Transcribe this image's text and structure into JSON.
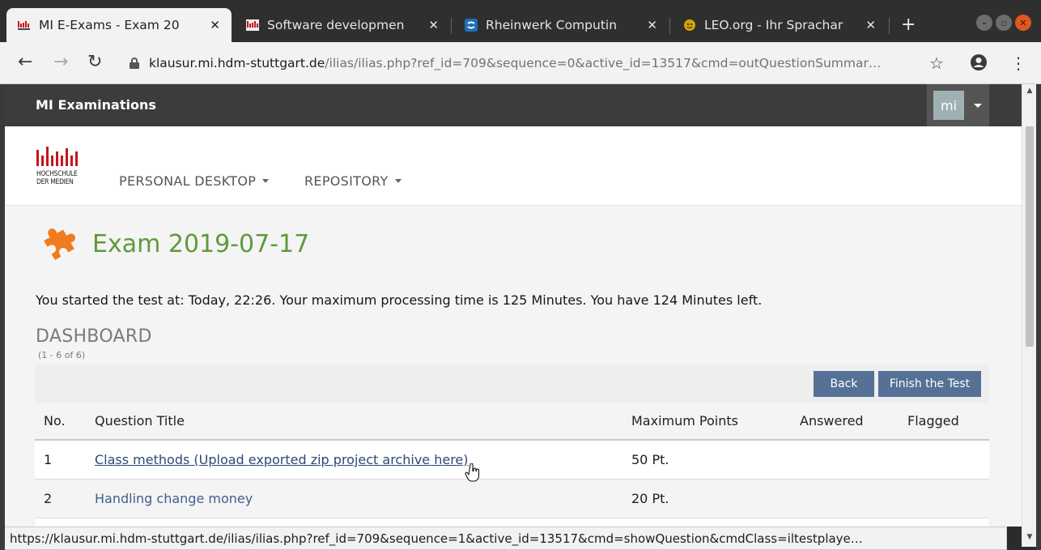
{
  "browser": {
    "tabs": [
      {
        "title": "MI E-Exams - Exam 20",
        "favicon": "hdm-logo-icon",
        "active": true
      },
      {
        "title": "Software developmen",
        "favicon": "hdm-logo-icon",
        "active": false
      },
      {
        "title": "Rheinwerk Computin",
        "favicon": "rheinwerk-icon",
        "active": false
      },
      {
        "title": "LEO.org - Ihr Sprachar",
        "favicon": "leo-icon",
        "active": false
      }
    ],
    "new_tab_label": "+",
    "url_host": "klausur.mi.hdm-stuttgart.de",
    "url_path": "/ilias/ilias.php?ref_id=709&sequence=0&active_id=13517&cmd=outQuestionSummar…",
    "status_url": "https://klausur.mi.hdm-stuttgart.de/ilias/ilias.php?ref_id=709&sequence=1&active_id=13517&cmd=showQuestion&cmdClass=iltestplaye…"
  },
  "app": {
    "brand": "MI Examinations",
    "user_initials": "mi",
    "logo_text_line1": "HOCHSCHULE",
    "logo_text_line2": "DER MEDIEN",
    "nav": {
      "personal_desktop": "PERSONAL DESKTOP",
      "repository": "REPOSITORY"
    }
  },
  "page": {
    "title": "Exam 2019-07-17",
    "info": "You started the test at: Today, 22:26. Your maximum processing time is 125 Minutes. You have 124 Minutes left.",
    "dashboard_title": "DASHBOARD",
    "dashboard_count": "(1 - 6 of 6)",
    "buttons": {
      "back": "Back",
      "finish": "Finish the Test"
    },
    "table": {
      "headers": {
        "no": "No.",
        "title": "Question Title",
        "max_points": "Maximum Points",
        "answered": "Answered",
        "flagged": "Flagged"
      },
      "rows": [
        {
          "no": "1",
          "title": "Class methods (Upload exported zip project archive here)",
          "points": "50 Pt."
        },
        {
          "no": "2",
          "title": "Handling change money",
          "points": "20 Pt."
        }
      ]
    }
  },
  "colors": {
    "title_green": "#5f9a3a",
    "button_blue": "#557196",
    "link_blue": "#3e5f8c",
    "logo_red": "#c4161c",
    "puzzle_orange": "#f07c1e"
  }
}
